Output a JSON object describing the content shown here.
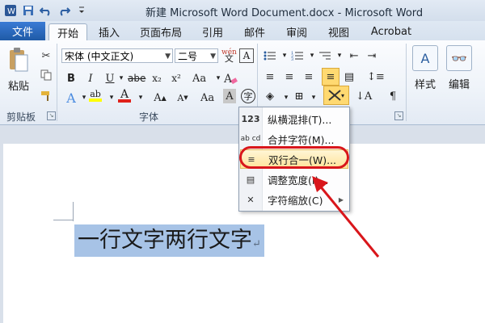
{
  "window": {
    "title": "新建 Microsoft Word Document.docx  -  Microsoft Word"
  },
  "tabs": {
    "file": "文件",
    "items": [
      "开始",
      "插入",
      "页面布局",
      "引用",
      "邮件",
      "审阅",
      "视图",
      "Acrobat"
    ]
  },
  "clipboard": {
    "paste_label": "粘贴",
    "group_label": "剪贴板"
  },
  "font": {
    "name": "宋体 (中文正文)",
    "size": "二号",
    "group_label": "字体",
    "wen_icon": "wén",
    "wen_char": "文",
    "bold": "B",
    "italic": "I",
    "underline": "U",
    "strike": "abe",
    "sub": "x₂",
    "sup": "x²",
    "grow": "A",
    "shrink": "A",
    "clear": "A",
    "effect": "A",
    "highlight": "ab",
    "color": "A",
    "charshade": "A",
    "enclose": "字"
  },
  "styles": {
    "label": "样式"
  },
  "editing": {
    "label": "编辑"
  },
  "menu": {
    "items": [
      {
        "icon": "123",
        "label": "纵横混排(T)..."
      },
      {
        "icon": "ab cd",
        "label": "合并字符(M)..."
      },
      {
        "icon": "≡",
        "label": "双行合一(W)..."
      },
      {
        "icon": "▤",
        "label": "调整宽度(I)..."
      },
      {
        "icon": "✕",
        "label": "字符缩放(C)"
      }
    ]
  },
  "document": {
    "selected_text": "一行文字两行文字"
  },
  "colors": {
    "accent": "#1f5aa6",
    "selection": "#a7c3e6",
    "annotation": "#d9161b"
  }
}
